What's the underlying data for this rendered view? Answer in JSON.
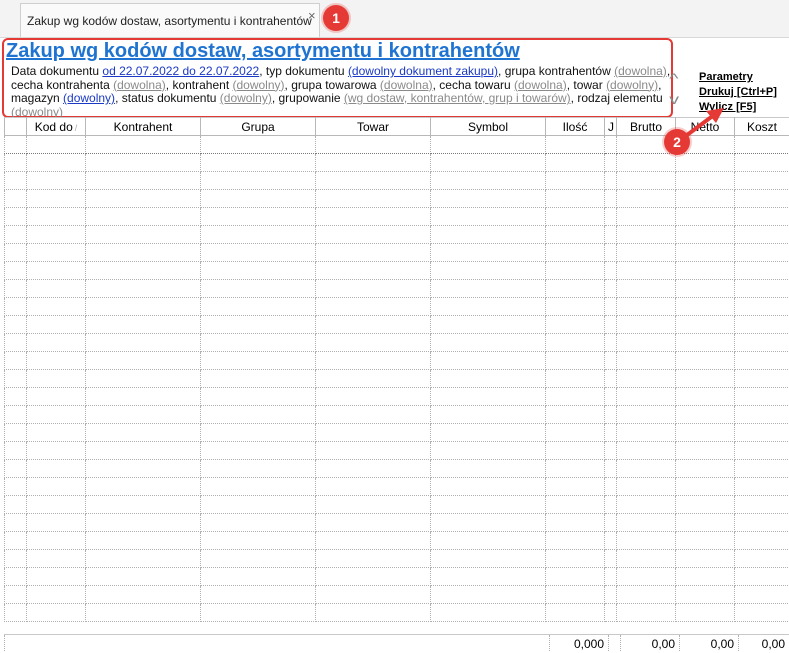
{
  "tab": {
    "title": "Zakup wg kodów dostaw, asortymentu i kontrahentów",
    "close_glyph": "×"
  },
  "badges": {
    "one": "1",
    "two": "2"
  },
  "report": {
    "title": "Zakup wg kodów dostaw, asortymentu i kontrahentów",
    "params": [
      {
        "text": "Data dokumentu ",
        "style": "plain"
      },
      {
        "text": "od 22.07.2022 do 22.07.2022",
        "style": "blue"
      },
      {
        "text": ", typ dokumentu ",
        "style": "plain"
      },
      {
        "text": "(dowolny dokument zakupu)",
        "style": "blue"
      },
      {
        "text": ", grupa kontrahentów ",
        "style": "plain"
      },
      {
        "text": "(dowolna)",
        "style": "gray"
      },
      {
        "text": ", cecha kontrahenta ",
        "style": "plain"
      },
      {
        "text": "(dowolna)",
        "style": "gray"
      },
      {
        "text": ", kontrahent ",
        "style": "plain"
      },
      {
        "text": "(dowolny)",
        "style": "gray"
      },
      {
        "text": ", grupa towarowa ",
        "style": "plain"
      },
      {
        "text": "(dowolna)",
        "style": "gray"
      },
      {
        "text": ", cecha towaru ",
        "style": "plain"
      },
      {
        "text": "(dowolna)",
        "style": "gray"
      },
      {
        "text": ", towar ",
        "style": "plain"
      },
      {
        "text": "(dowolny)",
        "style": "gray"
      },
      {
        "text": ", magazyn ",
        "style": "plain"
      },
      {
        "text": "(dowolny)",
        "style": "blue"
      },
      {
        "text": ", status dokumentu ",
        "style": "plain"
      },
      {
        "text": "(dowolny)",
        "style": "gray"
      },
      {
        "text": ", grupowanie ",
        "style": "plain"
      },
      {
        "text": "(wg dostaw, kontrahentów, grup i towarów)",
        "style": "gray"
      },
      {
        "text": ", rodzaj elementu ",
        "style": "plain"
      },
      {
        "text": "(dowolny)",
        "style": "gray"
      }
    ]
  },
  "actions": {
    "parametry": "Parametry",
    "drukuj": "Drukuj [Ctrl+P]",
    "wylicz": "Wylicz [F5]"
  },
  "scroll": {
    "up": "^",
    "down": "v"
  },
  "table": {
    "sort_mark": "/",
    "columns": [
      "",
      "Kod do",
      "Kontrahent",
      "Grupa",
      "Towar",
      "Symbol",
      "Ilość",
      "J",
      "Brutto",
      "Netto",
      "Koszt"
    ],
    "row_count": 27
  },
  "totals": {
    "ilosc": "0,000",
    "brutto": "0,00",
    "netto": "0,00",
    "koszt": "0,00"
  },
  "colors": {
    "accent_red": "#e53935",
    "title_blue": "#1f73d1",
    "link_blue": "#1a39c4",
    "link_gray": "#8a8a8a"
  }
}
